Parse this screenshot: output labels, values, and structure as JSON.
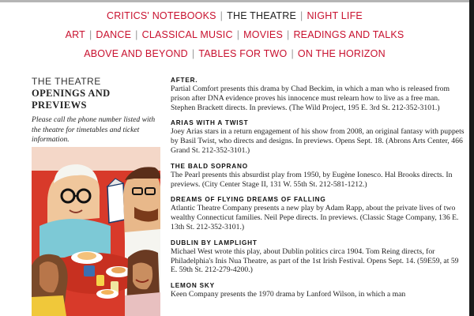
{
  "nav": {
    "row1": [
      "CRITICS' NOTEBOOKS",
      "THE THEATRE",
      "NIGHT LIFE"
    ],
    "row2": [
      "ART",
      "DANCE",
      "CLASSICAL MUSIC",
      "MOVIES",
      "READINGS AND TALKS"
    ],
    "row3": [
      "ABOVE AND BEYOND",
      "TABLES FOR TWO",
      "ON THE HORIZON"
    ]
  },
  "sidebar": {
    "section": "THE THEATRE",
    "subtitle": "OPENINGS AND PREVIEWS",
    "note": "Please call the phone number listed with the theatre for timetables and ticket information."
  },
  "entries": [
    {
      "title": "AFTER.",
      "body": "Partial Comfort presents this drama by Chad Beckim, in which a man who is released from prison after DNA evidence proves his innocence must relearn how to live as a free man. Stephen Brackett directs. In previews. (The Wild Project, 195 E. 3rd St. 212-352-3101.)"
    },
    {
      "title": "ARIAS WITH A TWIST",
      "body": "Joey Arias stars in a return engagement of his show from 2008, an original fantasy with puppets by Basil Twist, who directs and designs. In previews. Opens Sept. 18. (Abrons Arts Center, 466 Grand St. 212-352-3101.)"
    },
    {
      "title": "THE BALD SOPRANO",
      "body": "The Pearl presents this absurdist play from 1950, by Eugène Ionesco. Hal Brooks directs. In previews. (City Center Stage II, 131 W. 55th St. 212-581-1212.)"
    },
    {
      "title": "DREAMS OF FLYING DREAMS OF FALLING",
      "body": "Atlantic Theatre Company presents a new play by Adam Rapp, about the private lives of two wealthy Connecticut families. Neil Pepe directs. In previews. (Classic Stage Company, 136 E. 13th St. 212-352-3101.)"
    },
    {
      "title": "DUBLIN BY LAMPLIGHT",
      "body": "Michael West wrote this play, about Dublin politics circa 1904. Tom Reing directs, for Philadelphia's Inis Nua Theatre, as part of the 1st Irish Festival. Opens Sept. 14. (59E59, at 59 E. 59th St. 212-279-4200.)"
    },
    {
      "title": "LEMON SKY",
      "body": "Keen Company presents the 1970 drama by Lanford Wilson, in which a man"
    }
  ],
  "colors": {
    "link": "#c8102e",
    "current": "#222222",
    "illustration_bg": "#d83a2a"
  }
}
